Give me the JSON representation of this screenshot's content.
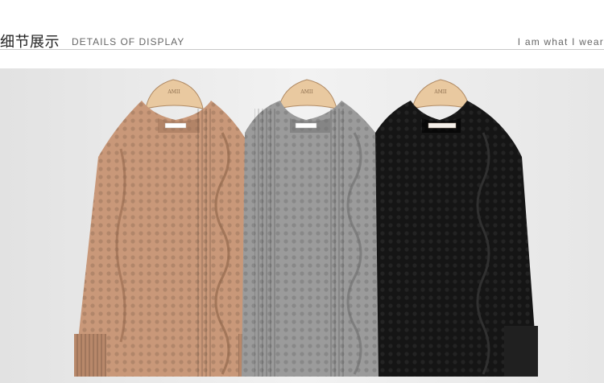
{
  "header": {
    "title_cn": "细节展示",
    "title_en": "DETAILS OF DISPLAY",
    "tagline": "I am what I wear"
  },
  "photo": {
    "hanger_text": "AMII",
    "items": [
      {
        "color_name": "camel",
        "color": "#c99879"
      },
      {
        "color_name": "grey",
        "color": "#9b9b9b"
      },
      {
        "color_name": "black",
        "color": "#151515"
      }
    ],
    "background_color": "#ebebeb"
  }
}
